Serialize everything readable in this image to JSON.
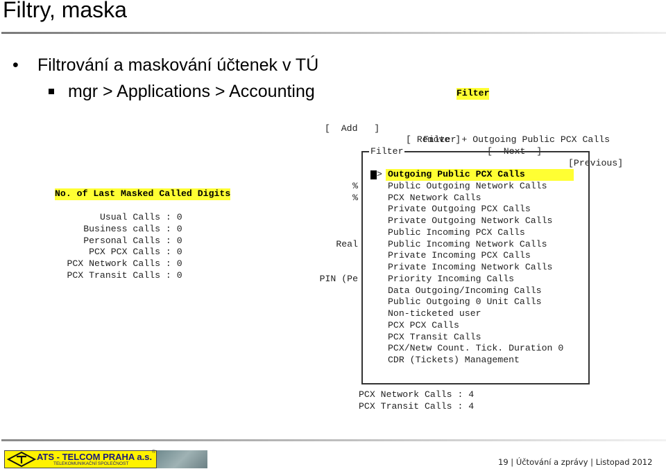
{
  "slide": {
    "title": "Filtry, maska",
    "bullet1": "Filtrování a maskování účtenek v TÚ",
    "bullet2": "mgr > Applications > Accounting"
  },
  "filter_screen": {
    "heading": "Filter",
    "buttons": [
      "[  Add   ]",
      "[ Remove ]",
      "[  Next  ]",
      "[Previous]"
    ],
    "subtitle": "Filter + Outgoing Public PCX Calls",
    "box_legend": "Filter",
    "arrow": ">",
    "behind_labels": [
      "%",
      "%",
      "",
      "",
      "",
      "Real",
      "",
      "",
      "PIN (Pe"
    ],
    "selected_index": 0,
    "items": [
      "Outgoing Public PCX Calls",
      "Public Outgoing Network Calls",
      "PCX Network Calls",
      "Private Outgoing PCX Calls",
      "Private Outgoing Network Calls",
      "Public Incoming PCX Calls",
      "Public Incoming Network Calls",
      "Private Incoming PCX Calls",
      "Private Incoming Network Calls",
      "Priority Incoming Calls",
      "Data Outgoing/Incoming Calls",
      "Public Outgoing 0 Unit Calls",
      "Non-ticketed user",
      "PCX PCX Calls",
      "PCX Transit Calls",
      "PCX/Netw Count. Tick. Duration 0",
      "CDR (Tickets) Management"
    ],
    "below_rows": [
      {
        "label": "PCX Network Calls",
        "value": "4"
      },
      {
        "label": "PCX Transit Calls",
        "value": "4"
      }
    ]
  },
  "mask_screen": {
    "heading": "No. of Last Masked Called Digits",
    "rows": [
      {
        "label": "Usual Calls",
        "value": "0"
      },
      {
        "label": "Business calls",
        "value": "0"
      },
      {
        "label": "Personal Calls",
        "value": "0"
      },
      {
        "label": "PCX PCX Calls",
        "value": "0"
      },
      {
        "label": "PCX Network Calls",
        "value": "0"
      },
      {
        "label": "PCX Transit Calls",
        "value": "0"
      }
    ]
  },
  "footer": {
    "logo_name": "ATS - TELCOM PRAHA a.s.",
    "logo_sub": "TELEKOMUNIKAČNÍ SPOLEČNOST",
    "logo_reg": "®",
    "text": "19 |   Účtování a zprávy | Listopad 2012"
  },
  "colors": {
    "highlight": "#ffff33"
  }
}
